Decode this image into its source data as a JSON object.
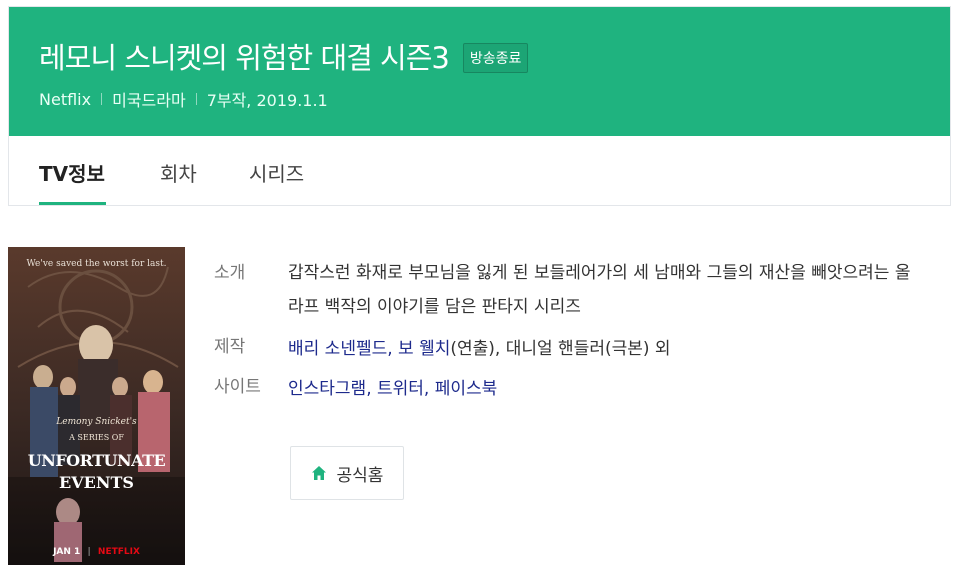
{
  "header": {
    "title": "레모니 스니켓의 위험한 대결 시즌3",
    "badge": "방송종료",
    "meta": [
      "Netflix",
      "미국드라마",
      "7부작, 2019.1.1"
    ]
  },
  "tabs": [
    {
      "label": "TV정보",
      "active": true
    },
    {
      "label": "회차",
      "active": false
    },
    {
      "label": "시리즈",
      "active": false
    }
  ],
  "poster": {
    "tagline": "We've saved the worst for last.",
    "logo_line1": "Lemony Snicket's",
    "logo_line2": "A SERIES OF",
    "logo_line3": "UNFORTUNATE",
    "logo_line4": "EVENTS",
    "date": "JAN 1",
    "brand": "NETFLIX"
  },
  "info": {
    "intro_label": "소개",
    "intro_text": "갑작스런 화재로 부모님을 잃게 된 보들레어가의 세 남매와 그들의 재산을 빼앗으려는 올라프 백작의 이야기를 담은 판타지 시리즈",
    "production_label": "제작",
    "production_links": "배리 소넨펠드, 보 웰치",
    "production_role1": "(연출), ",
    "production_writer": "대니얼 핸들러",
    "production_role2": "(극본) 외",
    "site_label": "사이트",
    "site_links": "인스타그램, 트위터, 페이스북"
  },
  "home_button": {
    "label": "공식홈",
    "icon": "home-icon"
  },
  "colors": {
    "accent": "#1fb37f",
    "link": "#1d2a8c"
  }
}
